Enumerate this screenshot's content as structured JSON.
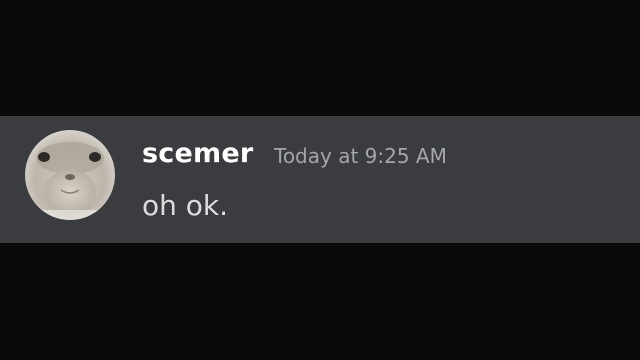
{
  "message": {
    "avatar_icon": "cat-face-avatar",
    "username": "scemer",
    "timestamp": "Today at 9:25 AM",
    "content": "oh ok."
  },
  "colors": {
    "background": "#0a0a0b",
    "message_background": "#3b3c40",
    "username": "#ffffff",
    "timestamp": "#a3a6aa",
    "content": "#dcddde"
  }
}
